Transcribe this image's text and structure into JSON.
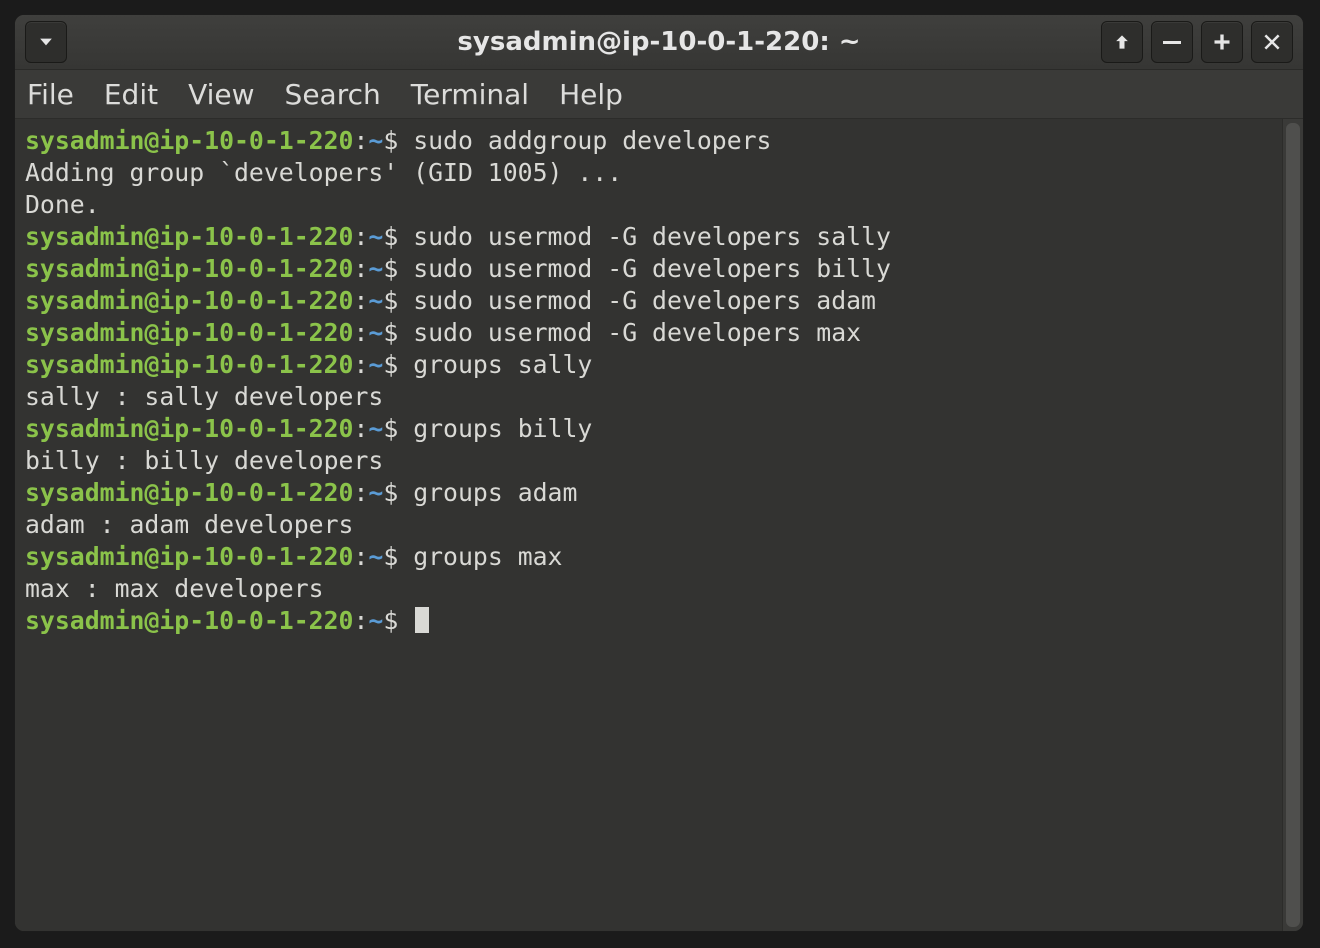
{
  "window": {
    "title": "sysadmin@ip-10-0-1-220: ~"
  },
  "menubar": {
    "items": [
      "File",
      "Edit",
      "View",
      "Search",
      "Terminal",
      "Help"
    ]
  },
  "prompt": {
    "user_host": "sysadmin@ip-10-0-1-220",
    "sep": ":",
    "path": "~",
    "symbol": "$"
  },
  "lines": [
    {
      "type": "cmd",
      "text": "sudo addgroup developers"
    },
    {
      "type": "out",
      "text": "Adding group `developers' (GID 1005) ..."
    },
    {
      "type": "out",
      "text": "Done."
    },
    {
      "type": "cmd",
      "text": "sudo usermod -G developers sally"
    },
    {
      "type": "cmd",
      "text": "sudo usermod -G developers billy"
    },
    {
      "type": "cmd",
      "text": "sudo usermod -G developers adam"
    },
    {
      "type": "cmd",
      "text": "sudo usermod -G developers max"
    },
    {
      "type": "cmd",
      "text": "groups sally"
    },
    {
      "type": "out",
      "text": "sally : sally developers"
    },
    {
      "type": "cmd",
      "text": "groups billy"
    },
    {
      "type": "out",
      "text": "billy : billy developers"
    },
    {
      "type": "cmd",
      "text": "groups adam"
    },
    {
      "type": "out",
      "text": "adam : adam developers"
    },
    {
      "type": "cmd",
      "text": "groups max"
    },
    {
      "type": "out",
      "text": "max : max developers"
    },
    {
      "type": "cmd",
      "text": "",
      "cursor": true
    }
  ]
}
